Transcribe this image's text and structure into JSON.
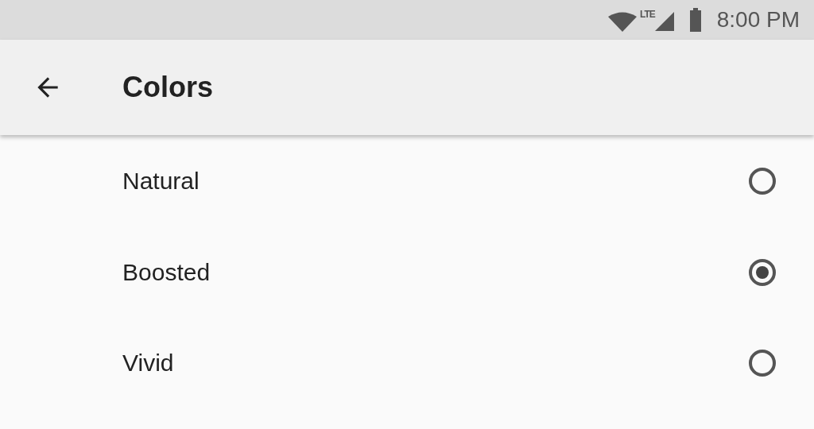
{
  "status_bar": {
    "network": "LTE",
    "time": "8:00 PM"
  },
  "app_bar": {
    "title": "Colors"
  },
  "options": [
    {
      "label": "Natural",
      "selected": false
    },
    {
      "label": "Boosted",
      "selected": true
    },
    {
      "label": "Vivid",
      "selected": false
    }
  ]
}
